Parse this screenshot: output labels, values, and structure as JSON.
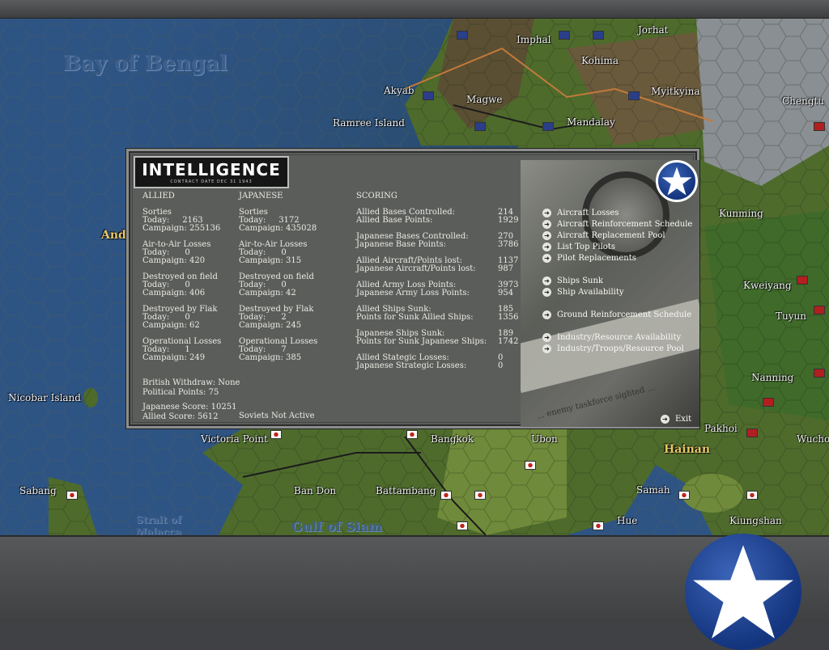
{
  "map": {
    "sea_labels": [
      "Bay of Bengal",
      "Gulf of Siam",
      "Strait of",
      "Malacca"
    ],
    "region_labels": [
      "Hainan",
      "Anda"
    ],
    "places": [
      "Imphal",
      "Jorhat",
      "Kohima",
      "Akyab",
      "Magwe",
      "Myitkyina",
      "Ramree Island",
      "Mandalay",
      "Chengtu",
      "Kunming",
      "Kweiyang",
      "Tuyun",
      "Nanning",
      "Nicobar Island",
      "Pakhoi",
      "Wucho",
      "Victoria Point",
      "Bangkok",
      "Ubon",
      "Sabang",
      "Ban Don",
      "Battambang",
      "Samah",
      "Hue",
      "Kiungshan"
    ]
  },
  "intel": {
    "title": "INTELLIGENCE",
    "contract_date": "CONTRACT DATE DEC 31 1943",
    "allied": {
      "header": "ALLIED",
      "sorties": "Sorties\nToday:     2163\nCampaign: 255136",
      "air_to_air": "Air-to-Air Losses\nToday:      0\nCampaign: 420",
      "destroyed_field": "Destroyed on field\nToday:      0\nCampaign: 406",
      "destroyed_flak": "Destroyed by Flak\nToday:      0\nCampaign: 62",
      "operational": "Operational Losses\nToday:      1\nCampaign: 249",
      "withdraw": "British Withdraw: None\nPolitical Points: 75",
      "scores": "Japanese Score: 10251\nAllied Score: 5612"
    },
    "japanese": {
      "header": "JAPANESE",
      "sorties": "Sorties\nToday:     3172\nCampaign: 435028",
      "air_to_air": "Air-to-Air Losses\nToday:      0\nCampaign: 315",
      "destroyed_field": "Destroyed on field\nToday:      0\nCampaign: 42",
      "destroyed_flak": "Destroyed by Flak\nToday:      2\nCampaign: 245",
      "operational": "Operational Losses\nToday:      7\nCampaign: 385",
      "soviets": "Soviets Not Active"
    },
    "scoring": {
      "header": "SCORING",
      "rows": [
        {
          "label": "Allied Bases Controlled:\nAllied Base Points:",
          "value": "214\n1929"
        },
        {
          "label": "Japanese Bases Controlled:\nJapanese Base Points:",
          "value": "270\n3786"
        },
        {
          "label": "Allied Aircraft/Points lost:\nJapanese Aircraft/Points lost:",
          "value": "1137\n987"
        },
        {
          "label": "Allied Army Loss Points:\nJapanese Army Loss Points:",
          "value": "3973\n954"
        },
        {
          "label": "Allied Ships Sunk:\nPoints for Sunk Allied Ships:",
          "value": "185\n1356"
        },
        {
          "label": "Japanese Ships Sunk:\nPoints for Sunk Japanese Ships:",
          "value": "189\n1742"
        },
        {
          "label": "Allied Stategic Losses:\nJapanese Strategic Losses:",
          "value": "0\n0"
        }
      ]
    },
    "menu": [
      "Aircraft Losses",
      "Aircraft Reinforcement Schedule",
      "Aircraft Replacement Pool",
      "List Top Pilots",
      "Pilot Replacements",
      "Ships Sunk",
      "Ship Availability",
      "Ground Reinforcement Schedule",
      "Industry/Resource Availability",
      "Industry/Troops/Resource Pool"
    ],
    "exit_label": "Exit",
    "photo_caption": "... enemy taskforce sighted ..."
  },
  "colors": {
    "sea": "#2e5484",
    "panel": "#5b5d5b",
    "allied_blue": "#14357e"
  },
  "icons": {
    "allied_star": "star-icon",
    "menu_arrow": "arrow-right-icon"
  }
}
